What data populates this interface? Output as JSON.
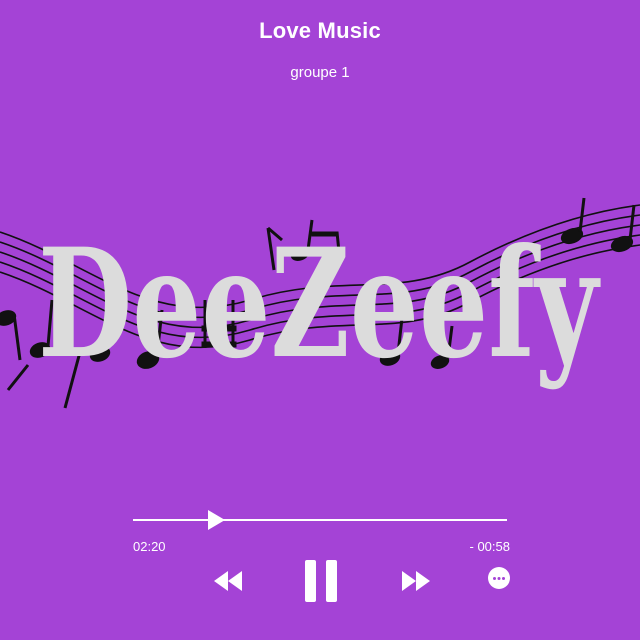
{
  "player": {
    "title": "Love Music",
    "artist": "groupe 1",
    "artwork_logo": "DeeZeefy"
  },
  "progress": {
    "elapsed": "02:20",
    "remaining": "- 00:58",
    "fraction": 0.21
  },
  "controls": {
    "rewind_icon": "rewind-icon",
    "pause_icon": "pause-icon",
    "forward_icon": "fast-forward-icon",
    "more_icon": "more-options-icon"
  },
  "colors": {
    "background": "#a443d6",
    "foreground": "#ffffff",
    "logo": "#dcdcdc",
    "notes": "#111111"
  }
}
